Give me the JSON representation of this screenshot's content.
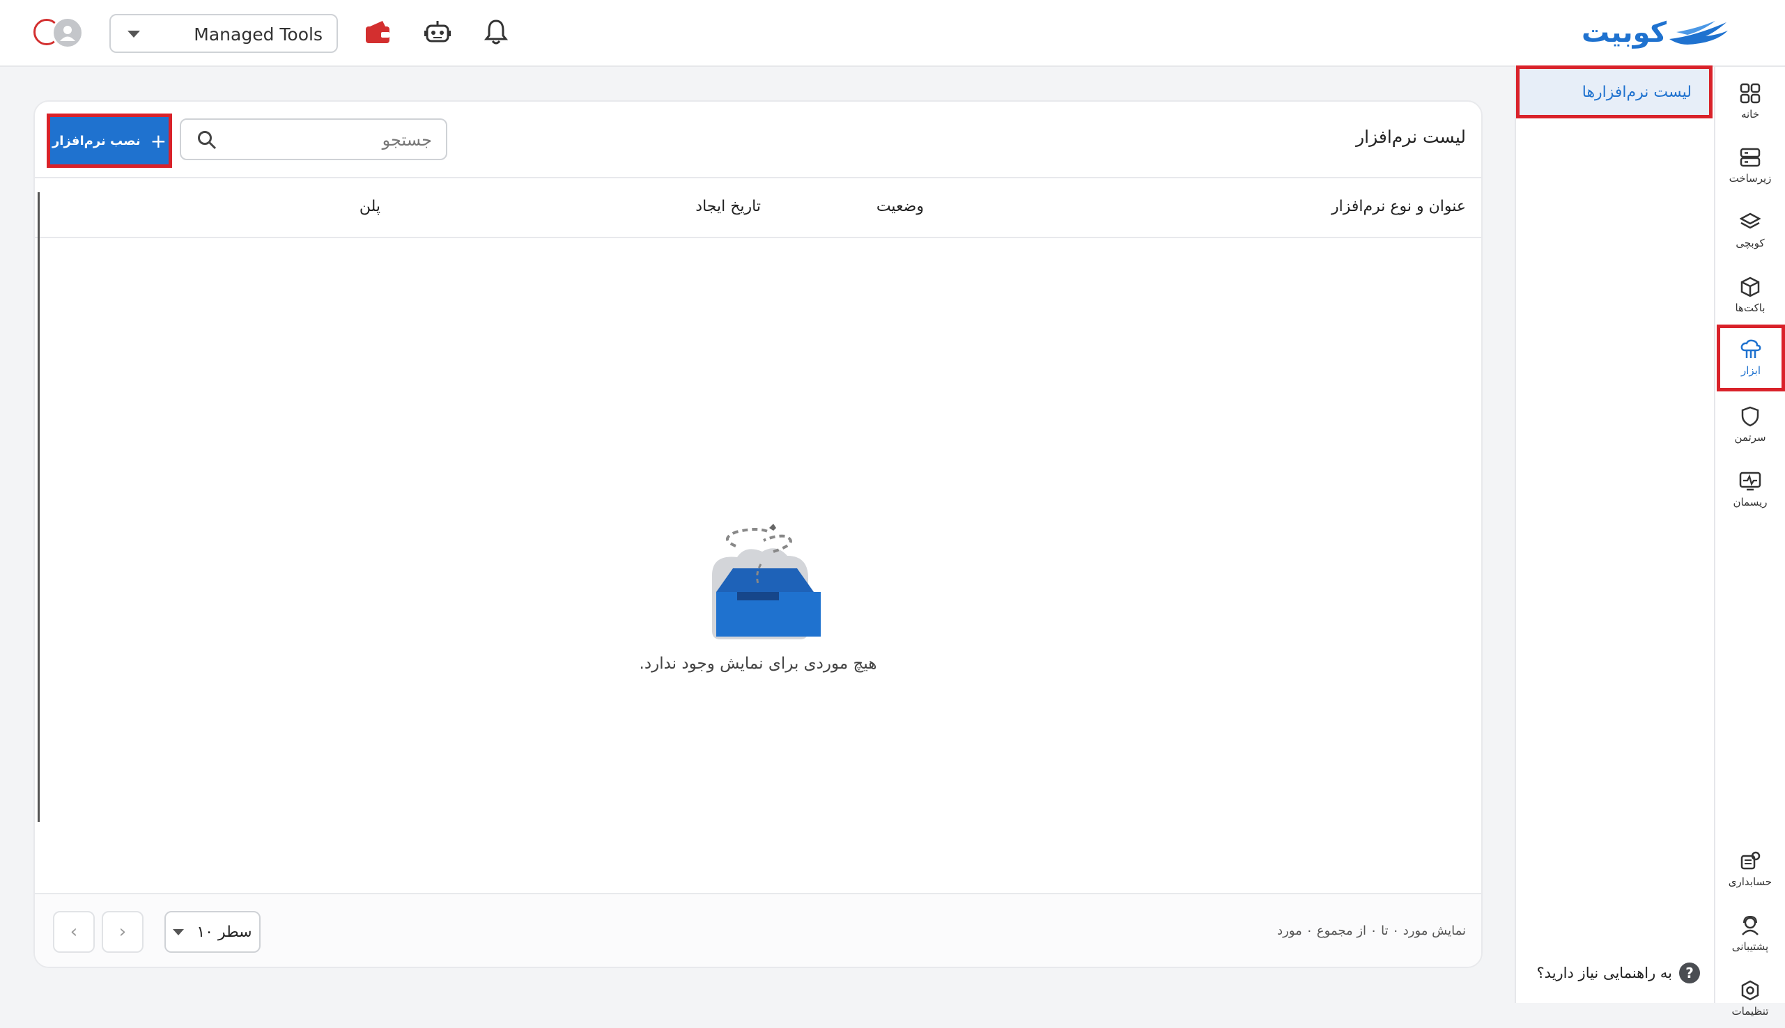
{
  "header": {
    "logo_text": "کوبیت",
    "tool_selector_value": "Managed Tools",
    "icons": [
      "bell-icon",
      "robot-icon",
      "wallet-icon"
    ]
  },
  "rail": {
    "items": [
      {
        "label": "خانه",
        "icon": "grid-icon"
      },
      {
        "label": "زیرساخت",
        "icon": "server-icon"
      },
      {
        "label": "کوبچی",
        "icon": "layers-icon"
      },
      {
        "label": "باکت‌ها",
        "icon": "box-icon"
      },
      {
        "label": "ابزار",
        "icon": "cloud-tools-icon",
        "active": true
      },
      {
        "label": "سرتمن",
        "icon": "shield-icon"
      },
      {
        "label": "ریسمان",
        "icon": "monitor-pulse-icon"
      }
    ],
    "bottom_items": [
      {
        "label": "حسابداری",
        "icon": "accounting-icon"
      },
      {
        "label": "پشتیبانی",
        "icon": "support-icon"
      },
      {
        "label": "تنظیمات",
        "icon": "settings-icon"
      }
    ]
  },
  "subside": {
    "selected_item": "لیست نرم‌افزارها",
    "help_text": "به راهنمایی نیاز دارید؟"
  },
  "main": {
    "title": "لیست نرم‌افزار",
    "search_placeholder": "جستجو",
    "install_button": "نصب نرم‌افزار",
    "columns": [
      "عنوان و نوع نرم‌افزار",
      "وضعیت",
      "تاریخ ایجاد",
      "پلن"
    ],
    "empty_message": "هیچ موردی برای نمایش وجود ندارد.",
    "footer": {
      "range_text": "نمایش مورد ۰ تا ۰ از مجموع ۰ مورد",
      "rows_per_page": "۱۰ سطر"
    }
  },
  "colors": {
    "brand": "#1f72cf",
    "highlight": "#d9222a",
    "wallet": "#d32f2f"
  }
}
